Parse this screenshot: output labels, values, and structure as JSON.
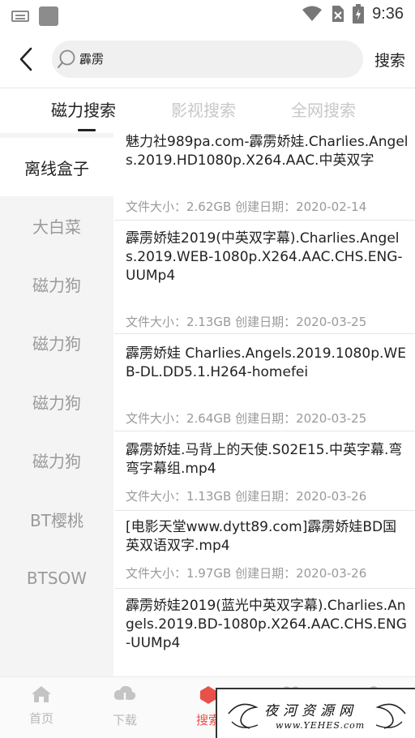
{
  "status_bar": {
    "time": "9:36"
  },
  "header": {
    "search_query": "霹雳",
    "search_button": "搜索"
  },
  "tabs": [
    {
      "label": "磁力搜索",
      "active": true
    },
    {
      "label": "影视搜索",
      "active": false
    },
    {
      "label": "全网搜索",
      "active": false
    }
  ],
  "sources": [
    {
      "label": "离线盒子",
      "active": true
    },
    {
      "label": "大白菜"
    },
    {
      "label": "磁力狗"
    },
    {
      "label": "磁力狗"
    },
    {
      "label": "磁力狗"
    },
    {
      "label": "磁力狗"
    },
    {
      "label": "BT樱桃"
    },
    {
      "label": "BTSOW"
    }
  ],
  "results": [
    {
      "title": "魅力社989pa.com-霹雳娇娃.Charlies.Angels.2019.HD1080p.X264.AAC.中英双字",
      "meta": "文件大小：2.62GB 创建日期：2020-02-14"
    },
    {
      "title": "霹雳娇娃2019(中英双字幕).Charlies.Angels.2019.WEB-1080p.X264.AAC.CHS.ENG-UUMp4",
      "meta": "文件大小：2.13GB 创建日期：2020-03-25"
    },
    {
      "title": "霹雳娇娃 Charlies.Angels.2019.1080p.WEB-DL.DD5.1.H264-homefei",
      "meta": "文件大小：2.64GB 创建日期：2020-03-25"
    },
    {
      "title": "霹雳娇娃.马背上的天使.S02E15.中英字幕.弯弯字幕组.mp4",
      "meta": "文件大小：1.13GB 创建日期：2020-03-26"
    },
    {
      "title": "[电影天堂www.dytt89.com]霹雳娇娃BD国英双语双字.mp4",
      "meta": "文件大小：1.97GB 创建日期：2020-03-26"
    },
    {
      "title": "霹雳娇娃2019(蓝光中英双字幕).Charlies.Angels.2019.BD-1080p.X264.AAC.CHS.ENG-UUMp4",
      "meta": ""
    }
  ],
  "bottom_nav": [
    {
      "label": "首页",
      "icon": "home-icon"
    },
    {
      "label": "下载",
      "icon": "download-icon"
    },
    {
      "label": "搜索",
      "icon": "search-icon",
      "active": true
    },
    {
      "label": "",
      "icon": "heart-icon"
    },
    {
      "label": "",
      "icon": "user-icon"
    }
  ],
  "watermark": {
    "cn": "夜河资源网",
    "en": "www.YEHES.com"
  },
  "colors": {
    "accent": "#e8514a",
    "muted": "#9a9a9a",
    "inactive_tab": "#c8c8c8"
  }
}
